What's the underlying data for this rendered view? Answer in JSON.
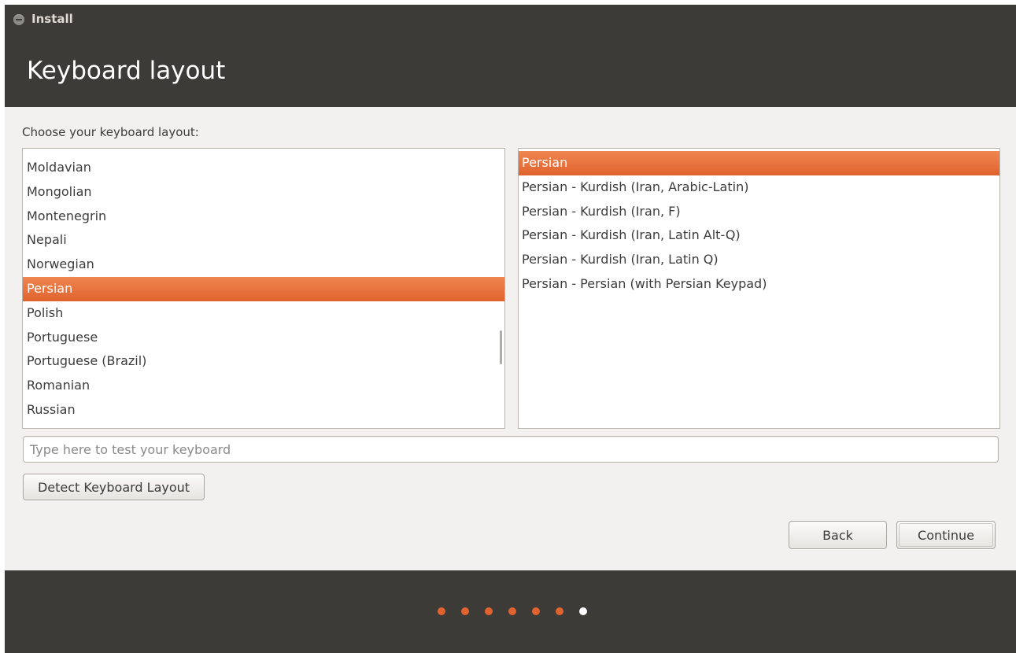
{
  "window": {
    "title": "Install"
  },
  "page": {
    "title": "Keyboard layout",
    "prompt": "Choose your keyboard layout:"
  },
  "layouts": {
    "items": [
      "Moldavian",
      "Mongolian",
      "Montenegrin",
      "Nepali",
      "Norwegian",
      "Persian",
      "Polish",
      "Portuguese",
      "Portuguese (Brazil)",
      "Romanian",
      "Russian"
    ],
    "selected": "Persian"
  },
  "variants": {
    "items": [
      "Persian",
      "Persian - Kurdish (Iran, Arabic-Latin)",
      "Persian - Kurdish (Iran, F)",
      "Persian - Kurdish (Iran, Latin Alt-Q)",
      "Persian - Kurdish (Iran, Latin Q)",
      "Persian - Persian (with Persian Keypad)"
    ],
    "selected": "Persian"
  },
  "test_input": {
    "placeholder": "Type here to test your keyboard",
    "value": ""
  },
  "buttons": {
    "detect": "Detect Keyboard Layout",
    "back": "Back",
    "continue": "Continue"
  },
  "progress": {
    "total_steps": 7,
    "current_step": 7,
    "done_color": "#e0622e",
    "current_color": "#ffffff"
  },
  "colors": {
    "accent": "#e0622e",
    "titlebar": "#3c3b37",
    "background": "#f2f1f0"
  }
}
